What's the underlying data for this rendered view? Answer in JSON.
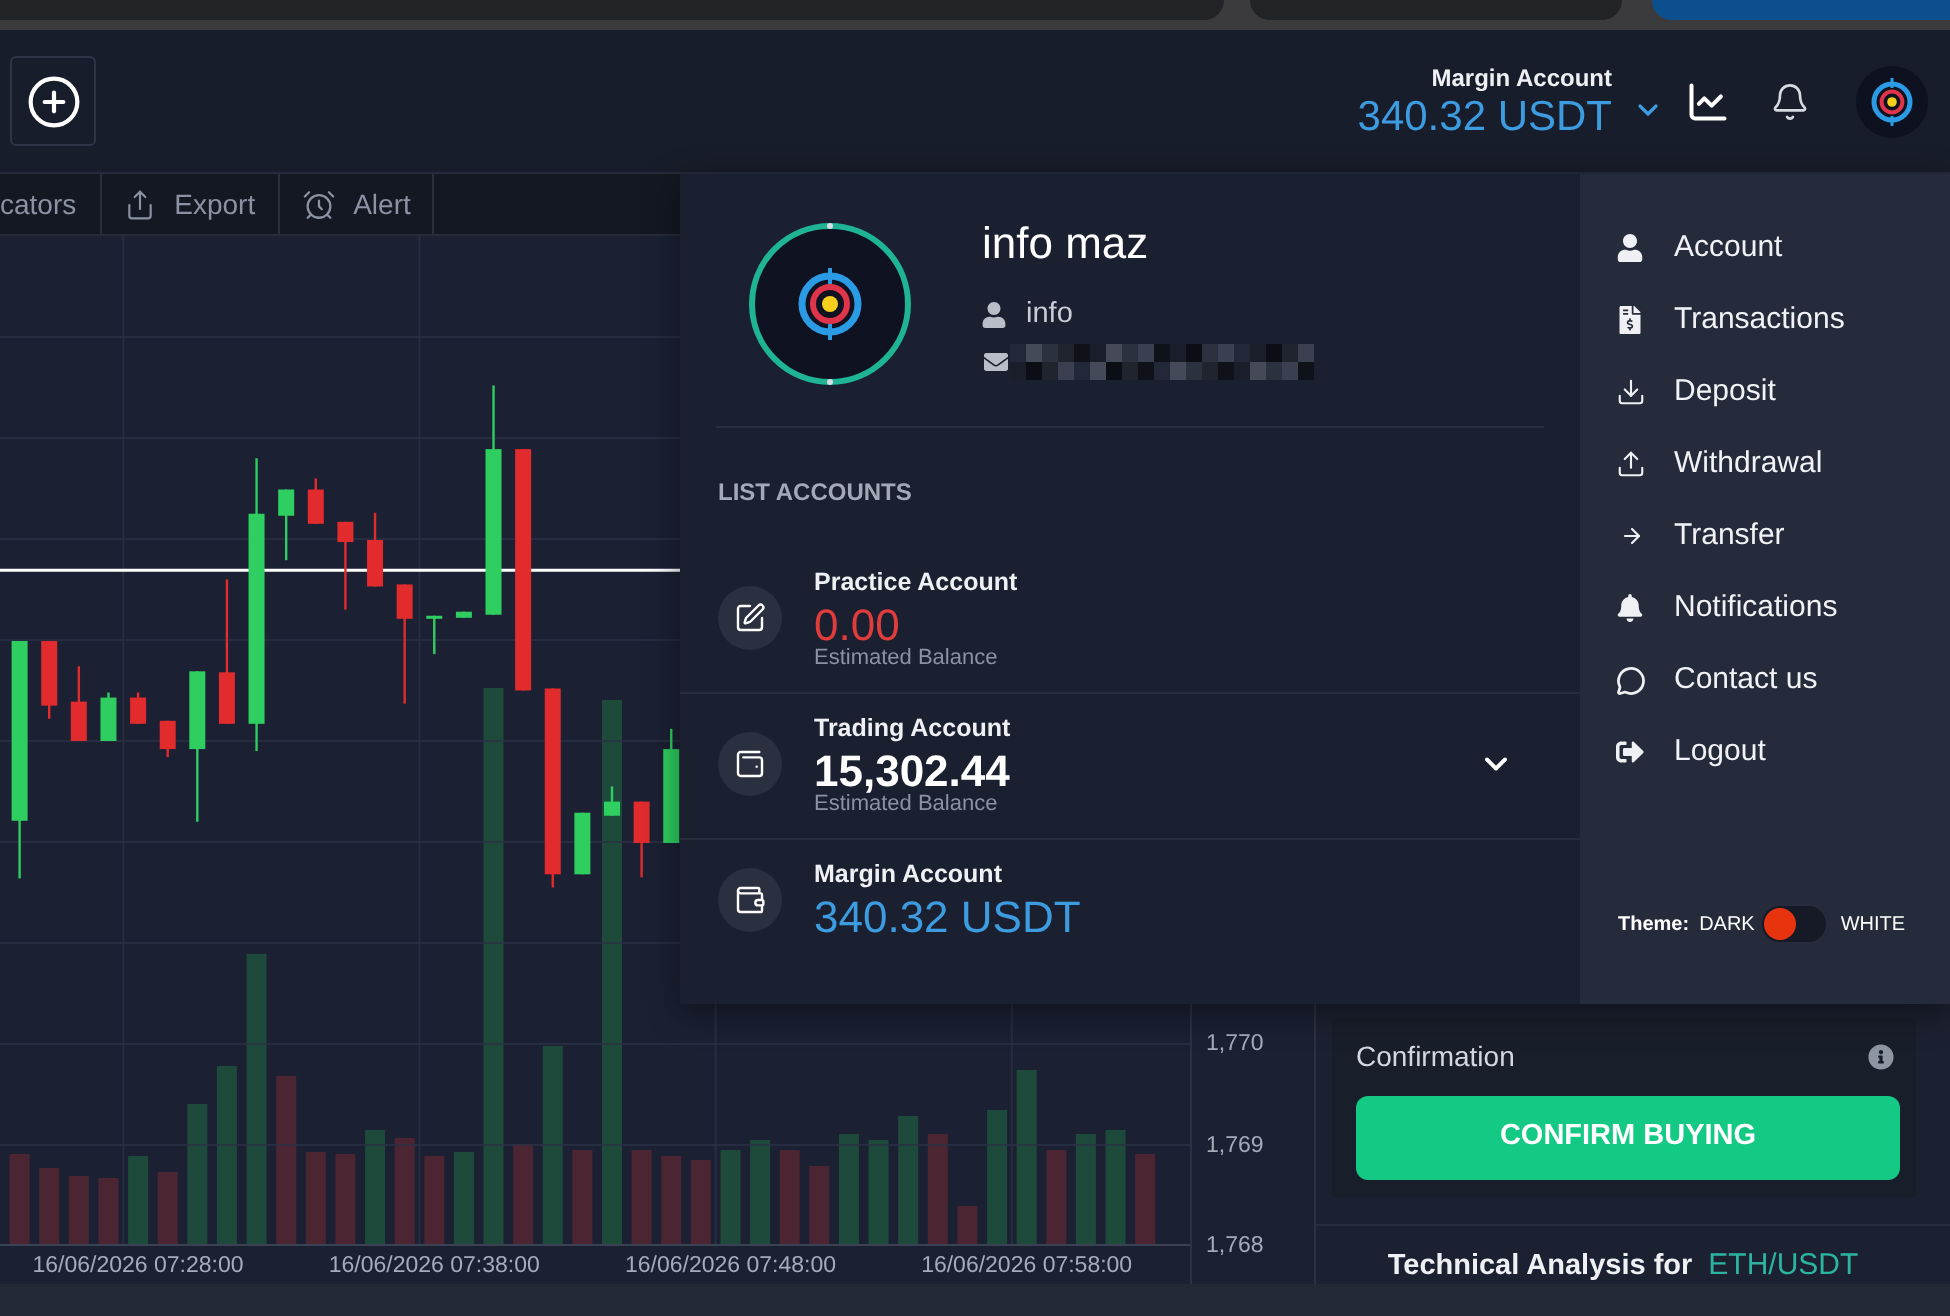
{
  "header": {
    "balance_label": "Margin Account",
    "balance_amount": "340.32 USDT"
  },
  "toolbar": [
    {
      "label": "cators",
      "kind": "plain"
    },
    {
      "label": "Export",
      "kind": "export"
    },
    {
      "label": "Alert",
      "kind": "alert"
    }
  ],
  "chart": {
    "chart_data": {
      "type": "candlestick",
      "categories": [
        null,
        null,
        null,
        null,
        "16/06/2026 07:28:00",
        null,
        null,
        null,
        null,
        null,
        null,
        null,
        null,
        null,
        "16/06/2026 07:38:00",
        null,
        null,
        null,
        null,
        null,
        null,
        null,
        null,
        null,
        "16/06/2026 07:48:00",
        null,
        null,
        null,
        null,
        null,
        null,
        null,
        null,
        null,
        "16/06/2026 07:58:00",
        null,
        null,
        null,
        null
      ],
      "ohlc": [
        [
          1772.21,
          1773.99,
          1771.64,
          1773.99
        ],
        [
          1773.99,
          1773.99,
          1773.22,
          1773.35
        ],
        [
          1773.39,
          1773.74,
          1773.0,
          1773.0
        ],
        [
          1773.0,
          1773.48,
          1773.0,
          1773.43
        ],
        [
          1773.43,
          1773.48,
          1773.17,
          1773.17
        ],
        [
          1773.2,
          1773.2,
          1772.84,
          1772.92
        ],
        [
          1772.92,
          1773.69,
          1772.2,
          1773.69
        ],
        [
          1773.68,
          1774.6,
          1773.17,
          1773.17
        ],
        [
          1773.17,
          1775.8,
          1772.9,
          1775.25
        ],
        [
          1775.23,
          1775.49,
          1774.79,
          1775.49
        ],
        [
          1775.49,
          1775.6,
          1775.15,
          1775.15
        ],
        [
          1775.17,
          1775.17,
          1774.3,
          1774.97
        ],
        [
          1774.99,
          1775.26,
          1774.53,
          1774.53
        ],
        [
          1774.55,
          1774.55,
          1773.37,
          1774.21
        ],
        [
          1774.21,
          1774.24,
          1773.86,
          1774.24
        ],
        [
          1774.22,
          1774.28,
          1774.22,
          1774.28
        ],
        [
          1774.25,
          1776.52,
          1774.25,
          1775.89
        ],
        [
          1775.89,
          1775.89,
          1773.5,
          1773.5
        ],
        [
          1773.52,
          1773.52,
          1771.55,
          1771.68
        ],
        [
          1771.68,
          1772.29,
          1771.68,
          1772.29
        ],
        [
          1772.26,
          1772.55,
          1772.26,
          1772.4
        ],
        [
          1772.4,
          1772.4,
          1771.65,
          1771.99
        ],
        [
          1771.99,
          1773.12,
          1771.99,
          1772.92
        ],
        null,
        null,
        null,
        null,
        null,
        null,
        null,
        null,
        null,
        null,
        null,
        null,
        null,
        null,
        null,
        null
      ],
      "ylim": [
        1768,
        1778
      ],
      "yticks": [
        {
          "value": 1770,
          "label": "1,770"
        },
        {
          "value": 1769,
          "label": "1,769"
        },
        {
          "value": 1768,
          "label": "1,768"
        }
      ],
      "ref_lines": [
        {
          "axis": "y",
          "value": 1774.69
        }
      ]
    }
  },
  "order_panel": {
    "confirmation_title": "Confirmation",
    "confirm_button": "CONFIRM BUYING",
    "analysis_prefix": "Technical Analysis for",
    "analysis_pair": "ETH/USDT"
  },
  "profile_menu": {
    "name": "info maz",
    "username": "info",
    "accounts_title": "LIST ACCOUNTS",
    "accounts": [
      {
        "kind": "practice",
        "name": "Practice Account",
        "balance": "0.00",
        "color": "#e03c3c",
        "note": "Estimated Balance",
        "expandable": false
      },
      {
        "kind": "trading",
        "name": "Trading Account",
        "balance": "15,302.44",
        "color": "#ffffff",
        "note": "Estimated Balance",
        "expandable": true
      },
      {
        "kind": "margin",
        "name": "Margin Account",
        "balance": "340.32 USDT",
        "color": "#3d9be0",
        "expandable": false
      }
    ],
    "links": [
      {
        "label": "Account",
        "kind": "user"
      },
      {
        "label": "Transactions",
        "kind": "invoice"
      },
      {
        "label": "Deposit",
        "kind": "deposit"
      },
      {
        "label": "Withdrawal",
        "kind": "withdrawal"
      },
      {
        "label": "Transfer",
        "kind": "transfer"
      },
      {
        "label": "Notifications",
        "kind": "bell"
      },
      {
        "label": "Contact us",
        "kind": "chat"
      },
      {
        "label": "Logout",
        "kind": "logout"
      }
    ],
    "theme": {
      "label": "Theme:",
      "dark_label": "DARK",
      "white_label": "WHITE",
      "on": false
    }
  }
}
